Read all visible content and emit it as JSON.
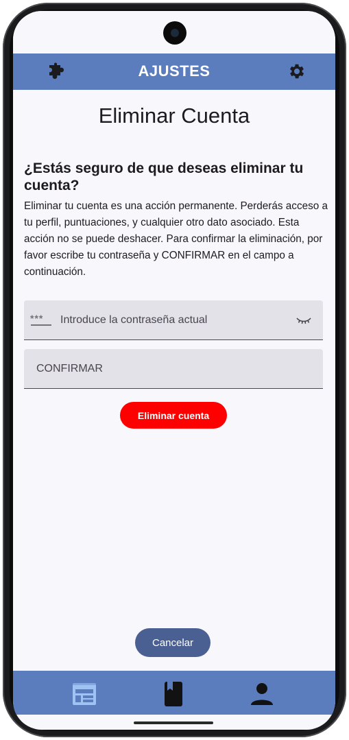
{
  "app_bar": {
    "title": "AJUSTES",
    "left_icon": "puzzle-piece-icon",
    "right_icon": "gear-icon"
  },
  "page": {
    "title": "Eliminar Cuenta",
    "question": "¿Estás seguro de que deseas eliminar tu cuenta?",
    "description": "Eliminar tu cuenta es una acción permanente. Perderás acceso a tu perfil, puntuaciones, y cualquier otro dato asociado. Esta acción no se puede deshacer. Para confirmar la eliminación, por favor escribe tu contraseña y CONFIRMAR en el campo a continuación."
  },
  "form": {
    "password_placeholder": "Introduce la contraseña actual",
    "password_value": "",
    "confirm_placeholder": "CONFIRMAR",
    "confirm_value": "",
    "leading_icon": "password-stars-icon",
    "trailing_icon": "eye-closed-icon"
  },
  "buttons": {
    "delete_label": "Eliminar cuenta",
    "cancel_label": "Cancelar"
  },
  "bottom_nav": {
    "items": [
      "feed-icon",
      "book-icon",
      "profile-icon"
    ],
    "active_index": 0
  },
  "colors": {
    "primary": "#5b7dbd",
    "danger": "#ff0000",
    "cancel": "#4a5f92",
    "active_nav": "#9fc3f3",
    "background": "#f8f7fc"
  }
}
